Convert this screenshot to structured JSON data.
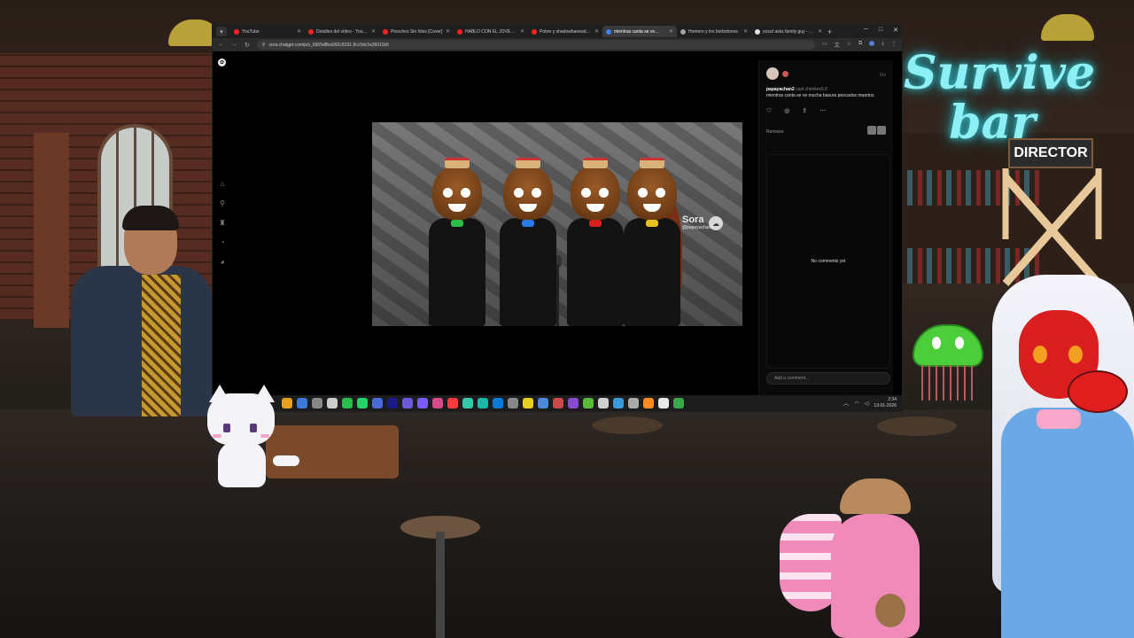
{
  "scene": {
    "neon_sign": [
      "Survive",
      "bar"
    ],
    "chair_sign": "DIRECTOR"
  },
  "browser": {
    "tabs": [
      {
        "label": "YouTube",
        "favicon_color": "#ff2020",
        "active": false
      },
      {
        "label": "Detalles del vídeo - YouTube",
        "favicon_color": "#ff2020",
        "active": false
      },
      {
        "label": "Pinoches Sin hilos [Cover]",
        "favicon_color": "#ff2020",
        "active": false
      },
      {
        "label": "HABLO CON EL JOVEN G...",
        "favicon_color": "#ff2020",
        "active": false
      },
      {
        "label": "Pobre y shadowbanead...",
        "favicon_color": "#ff2020",
        "active": false
      },
      {
        "label": "mientras canta se ve...",
        "favicon_color": "#3b82f6",
        "active": true
      },
      {
        "label": "Homero y los borbotones",
        "favicon_color": "#a0a0a0",
        "active": false
      },
      {
        "label": "yosuf asks family guy - Bú...",
        "favicon_color": "#e0e0e0",
        "active": false
      }
    ],
    "url": "sora.chatgpt.com/p/s_6965d8ba992c8191 8cc5dc3a36011b5"
  },
  "sora": {
    "post": {
      "username": "papayachan2",
      "cast": "cast chimitex5.0",
      "caption": "mientras canta se ve mucha basura pescados muertos",
      "time": "5m"
    },
    "remixes_label": "Remixes",
    "no_comments": "No comments yet",
    "comment_placeholder": "Add a comment...",
    "watermark_brand": "Sora",
    "watermark_user": "@papayachan2"
  },
  "taskbar": {
    "time": "2:34",
    "date": "13-01-2026",
    "icon_colors": [
      "#e8a020",
      "#3a7ad8",
      "#888",
      "#ccc",
      "#2bbd4a",
      "#25d366",
      "#4a6ad8",
      "#1a1a8a",
      "#6a5ad8",
      "#7a5af8",
      "#d84a8a",
      "#ff3a3a",
      "#33c8a8",
      "#19b8a8",
      "#0a7ad8",
      "#888",
      "#e8d020",
      "#4a8ad8",
      "#c84a4a",
      "#8a4ad8",
      "#5ab83a",
      "#d0d0d0",
      "#3a9ad8",
      "#aaa",
      "#ff8a20",
      "#e8e8e8",
      "#3aa84a"
    ]
  },
  "colors": {
    "accent_neon": "#8ef0f5",
    "page_bg": "#000000"
  }
}
